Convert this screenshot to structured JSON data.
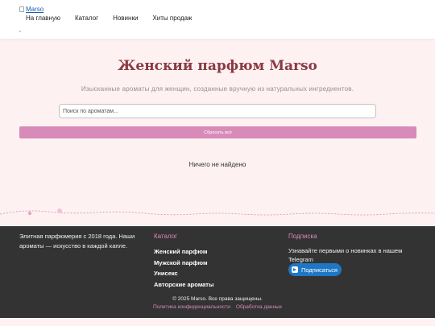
{
  "header": {
    "logo_alt": "Marso",
    "nav": [
      "На главную",
      "Каталог",
      "Новинки",
      "Хиты продаж"
    ]
  },
  "main": {
    "title": "Женский парфюм Marso",
    "subtitle": "Изысканные ароматы для женщин, созданные вручную из натуральных ингредиентов.",
    "search_placeholder": "Поиск по ароматам...",
    "reset_label": "Сбросить всё",
    "empty_message": "Ничего не найдено"
  },
  "footer": {
    "about": "Элитная парфюмерия с 2018 года. Наши ароматы — искусство в каждой капле.",
    "catalog_title": "Каталог",
    "catalog_links": [
      "Женский парфюм",
      "Мужской парфюм",
      "Унисекс",
      "Авторские ароматы"
    ],
    "subscribe_title": "Подписка",
    "subscribe_text": "Узнавайте первыми о новинках в нашем Telegram",
    "subscribe_button": "Подписаться",
    "copyright": "© 2025 Marso. Все права защищены.",
    "privacy_link": "Политика конфиденциальности",
    "data_link": "Обработка данных"
  },
  "colors": {
    "accent": "#d88bb8",
    "title": "#8a3a43",
    "page_bg": "#fdf1f2",
    "footer_bg": "#333333",
    "telegram": "#1e77c5"
  },
  "icons": {
    "logo": "broken-image-icon",
    "telegram": "telegram-icon"
  }
}
